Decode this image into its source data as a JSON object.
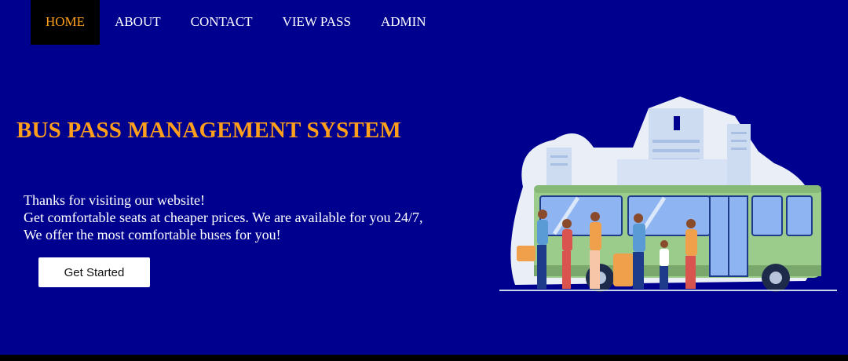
{
  "nav": {
    "items": [
      {
        "label": "HOME",
        "active": true
      },
      {
        "label": "ABOUT",
        "active": false
      },
      {
        "label": "CONTACT",
        "active": false
      },
      {
        "label": "VIEW PASS",
        "active": false
      },
      {
        "label": "ADMIN",
        "active": false
      }
    ]
  },
  "hero": {
    "title": "BUS PASS MANAGEMENT SYSTEM",
    "lines": [
      "Thanks for visiting our website!",
      "Get comfortable seats at cheaper prices. We are available for you 24/7,",
      "We offer the most comfortable buses for you!"
    ],
    "cta_label": "Get Started"
  },
  "illustration": {
    "icon": "bus-stop-illustration"
  },
  "colors": {
    "background": "#00008f",
    "accent": "#ff9f1c",
    "nav_active_bg": "#000000",
    "bus_body": "#9ccc8c"
  }
}
